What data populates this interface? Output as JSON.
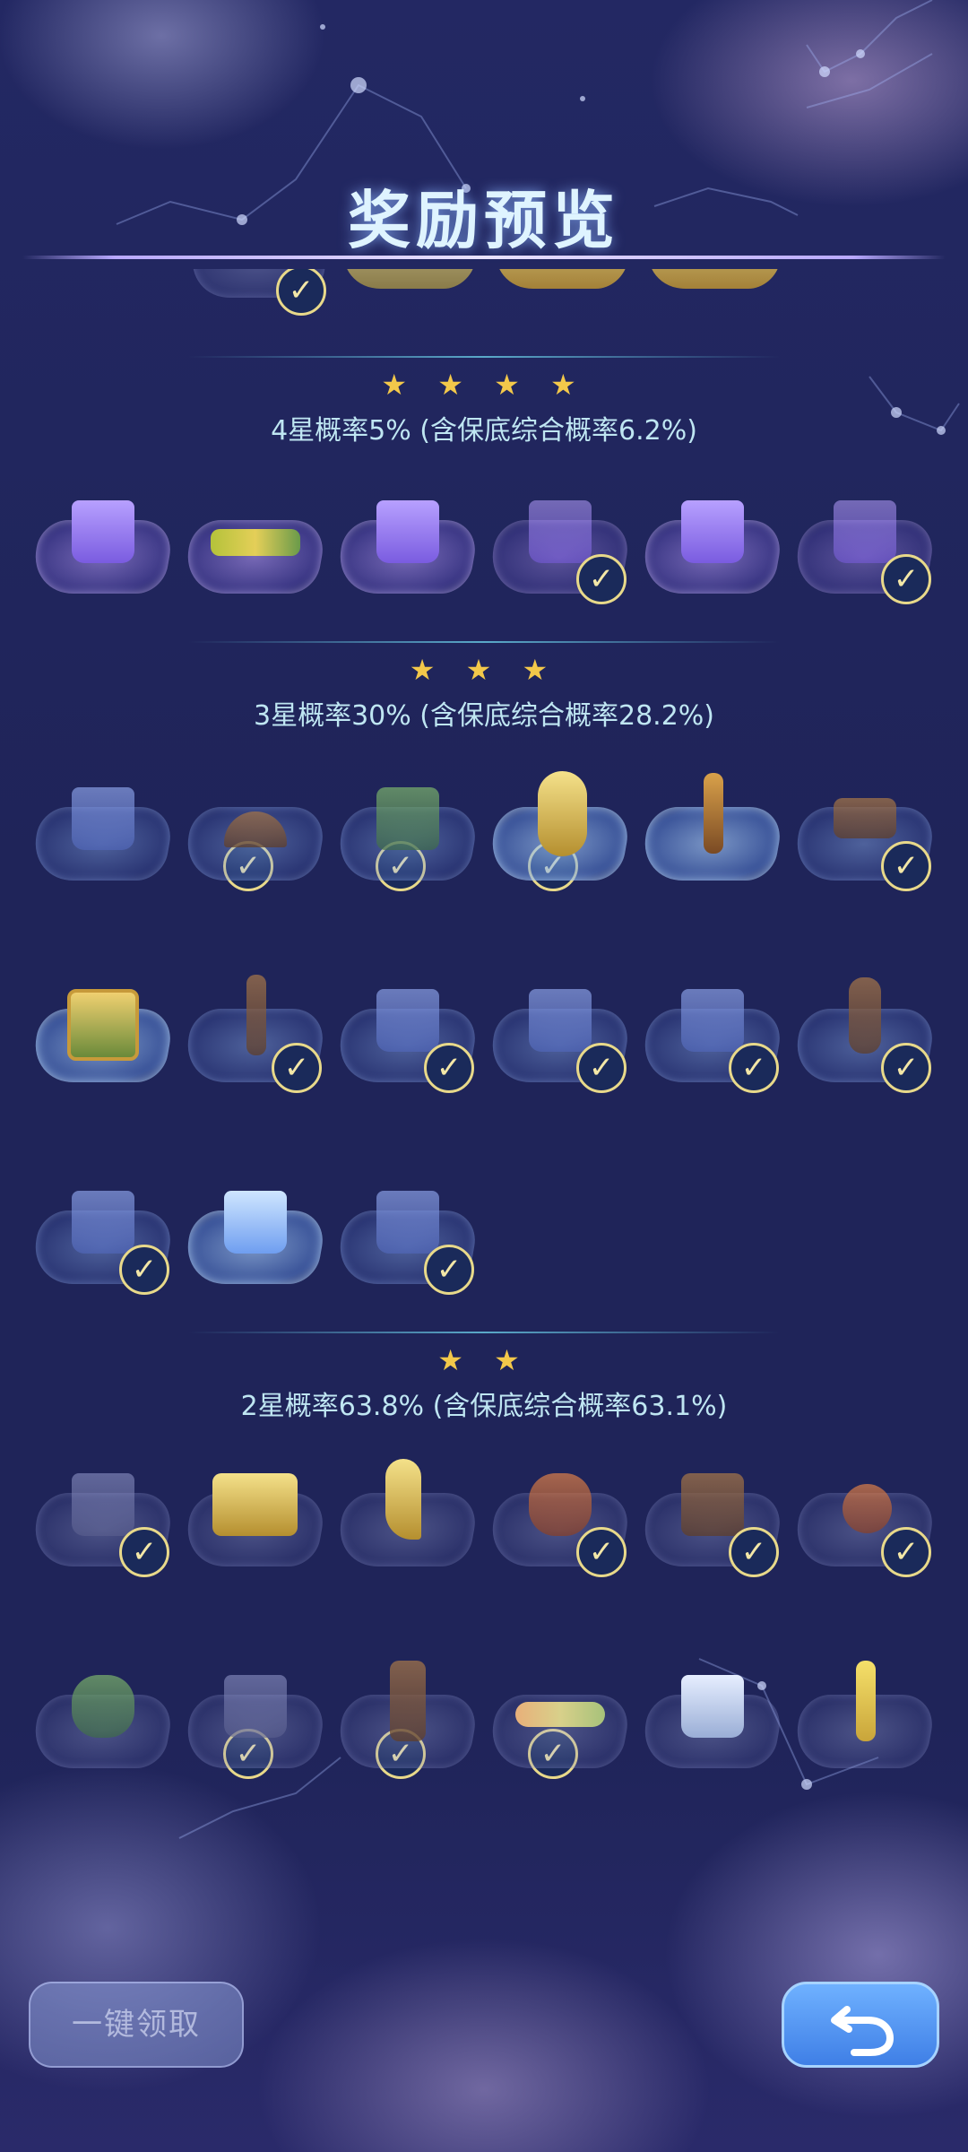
{
  "title": "奖励预览",
  "tiers": [
    {
      "stars": "★ ★ ★ ★",
      "text": "4星概率5% (含保底综合概率6.2%)"
    },
    {
      "stars": "★ ★ ★",
      "text": "3星概率30% (含保底综合概率28.2%)"
    },
    {
      "stars": "★ ★",
      "text": "2星概率63.8% (含保底综合概率63.1%)"
    }
  ],
  "check_glyph": "✓",
  "buttons": {
    "claim_all": "一键领取",
    "back_icon": "return-arrow-icon"
  },
  "colors": {
    "background": "#1e2256",
    "star": "#f3c84a",
    "title": "#dff4ff",
    "check_ring": "#e8d98a"
  }
}
